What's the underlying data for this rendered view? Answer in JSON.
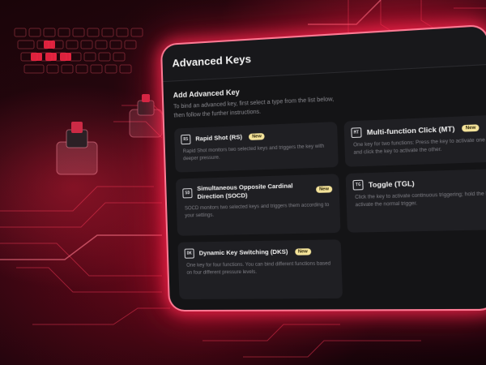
{
  "panel": {
    "title": "Advanced Keys"
  },
  "section": {
    "title": "Add Advanced Key",
    "description": "To bind an advanced key, first select a type from the list below, then follow the further instructions."
  },
  "cards": [
    {
      "icon": "rapid-shot-icon",
      "icon_glyph": "RS",
      "title": "Rapid Shot (RS)",
      "badge": "New",
      "description": "Rapid Shot monitors two selected keys and triggers the key with deeper pressure."
    },
    {
      "icon": "multi-function-click-icon",
      "icon_glyph": "MT",
      "title": "Multi-function Click (MT)",
      "badge": "New",
      "description": "One key for two functions: Press the key to activate one function, and click the key to activate the other."
    },
    {
      "icon": "socd-icon",
      "icon_glyph": "SD",
      "title": "Simultaneous Opposite Cardinal Direction (SOCD)",
      "badge": "New",
      "description": "SOCD monitors two selected keys and triggers them according to your settings."
    },
    {
      "icon": "toggle-icon",
      "icon_glyph": "TG",
      "title": "Toggle (TGL)",
      "badge": "",
      "description": "Click the key to activate continuous triggering; hold the key to activate the normal trigger."
    },
    {
      "icon": "dynamic-key-switching-icon",
      "icon_glyph": "DK",
      "title": "Dynamic Key Switching (DKS)",
      "badge": "New",
      "description": "One key for four functions. You can bind different functions based on four different pressure levels."
    }
  ],
  "colors": {
    "accent_glow": "#ff2a55",
    "badge_bg": "#f4e39a",
    "panel_bg": "#141416",
    "card_bg": "#1f1f23"
  }
}
